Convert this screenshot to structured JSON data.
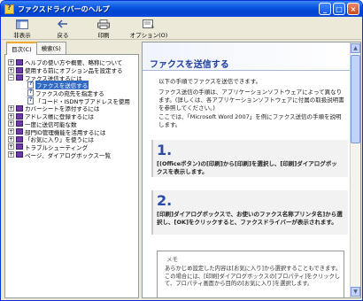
{
  "window": {
    "title": "ファクスドライバーのヘルプ"
  },
  "toolbar": {
    "hide": "非表示",
    "back": "戻る",
    "print": "印刷",
    "options": "オプション(O)"
  },
  "tabs": {
    "contents": "目次(C)",
    "search": "検索(S)"
  },
  "tree": [
    {
      "label": "ヘルプの使い方や概要、略称について",
      "type": "book",
      "expand": "+",
      "depth": 0,
      "selected": false
    },
    {
      "label": "使用する前にオプション品を設定する",
      "type": "book",
      "expand": "+",
      "depth": 0,
      "selected": false
    },
    {
      "label": "ファクス送信するには",
      "type": "book",
      "expand": "−",
      "depth": 0,
      "selected": false
    },
    {
      "label": "ファクスを送信する",
      "type": "page",
      "expand": "",
      "depth": 1,
      "selected": true
    },
    {
      "label": "ファクスの宛先を指定する",
      "type": "page",
      "expand": "",
      "depth": 1,
      "selected": false
    },
    {
      "label": "「コード・ISDNサブアドレスを使用",
      "type": "page",
      "expand": "",
      "depth": 1,
      "selected": false
    },
    {
      "label": "カバーシートを添付するには",
      "type": "book",
      "expand": "+",
      "depth": 0,
      "selected": false
    },
    {
      "label": "アドレス帳に登録するには",
      "type": "book",
      "expand": "+",
      "depth": 0,
      "selected": false
    },
    {
      "label": "一度に送信可能な数",
      "type": "book",
      "expand": "+",
      "depth": 0,
      "selected": false
    },
    {
      "label": "部門ID管理機能を活用するには",
      "type": "book",
      "expand": "+",
      "depth": 0,
      "selected": false
    },
    {
      "label": "「お気に入り」を使うには",
      "type": "book",
      "expand": "+",
      "depth": 0,
      "selected": false
    },
    {
      "label": "トラブルシューティング",
      "type": "book",
      "expand": "+",
      "depth": 0,
      "selected": false
    },
    {
      "label": "ページ、ダイアログボックス一覧",
      "type": "book",
      "expand": "+",
      "depth": 0,
      "selected": false
    }
  ],
  "content": {
    "title": "ファクスを送信する",
    "intro1": "以下の手順でファクスを送信できます。",
    "intro2": "ファクス送信の手順は、アプリケーションソフトウェアによって異なります。(詳しくは、各アプリケーションソフトウェアに付属の取扱説明書を参照してください。)",
    "intro3": "ここでは、「Microsoft Word 2007」を例にファクス送信の手順を説明します。",
    "step1_num": "1.",
    "step1_text": "[(Officeボタン)の[印刷]から[印刷]を選択し、[印刷]ダイアログボックスを表示します。",
    "step2_num": "2.",
    "step2_text": "[印刷]ダイアログボックスで、お使いのファクス名称プリンタ名]から選択し、[OK]をクリックすると、ファクスドライバーが表示されます。",
    "memo_title": "メモ",
    "memo_text": "あらかじめ設定した内容は[お気に入り]から選択することもできます。この場合には、[印刷]ダイアログボックスの[プロパティ]をクリックして、プロパティ画面から目的の[お気に入り]を選択します。"
  }
}
